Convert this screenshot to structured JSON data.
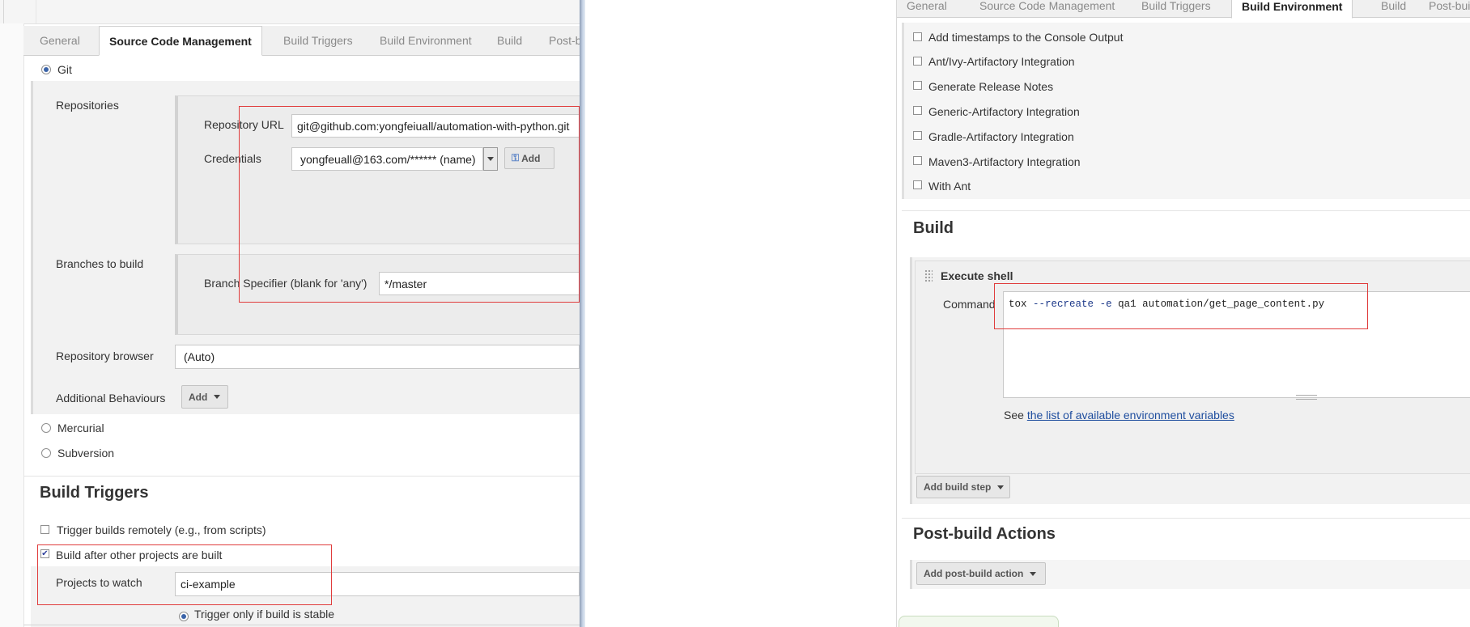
{
  "left_panel": {
    "tabs": [
      "General",
      "Source Code Management",
      "Build Triggers",
      "Build Environment",
      "Build",
      "Post-b"
    ],
    "active_tab": "Source Code Management",
    "scm": {
      "git_label": "Git",
      "repositories_label": "Repositories",
      "repo_url_label": "Repository URL",
      "repo_url_value": "git@github.com:yongfeiuall/automation-with-python.git",
      "credentials_label": "Credentials",
      "credentials_value": "yongfeuall@163.com/****** (name)",
      "add_cred_label": "Add",
      "branches_label": "Branches to build",
      "branch_specifier_label": "Branch Specifier (blank for 'any')",
      "branch_specifier_value": "*/master",
      "repo_browser_label": "Repository browser",
      "repo_browser_value": "(Auto)",
      "additional_behaviours_label": "Additional Behaviours",
      "add_behaviour_label": "Add",
      "mercurial_label": "Mercurial",
      "subversion_label": "Subversion"
    },
    "build_triggers": {
      "title": "Build Triggers",
      "trigger_remotely": "Trigger builds remotely (e.g., from scripts)",
      "build_after": "Build after other projects are built",
      "projects_to_watch_label": "Projects to watch",
      "projects_to_watch_value": "ci-example",
      "trigger_stable": "Trigger only if build is stable"
    }
  },
  "right_panel": {
    "tabs": [
      "General",
      "Source Code Management",
      "Build Triggers",
      "Build Environment",
      "Build",
      "Post-build"
    ],
    "active_tab": "Build Environment",
    "env_options": [
      "Add timestamps to the Console Output",
      "Ant/Ivy-Artifactory Integration",
      "Generate Release Notes",
      "Generic-Artifactory Integration",
      "Gradle-Artifactory Integration",
      "Maven3-Artifactory Integration",
      "With Ant"
    ],
    "build": {
      "title": "Build",
      "step_title": "Execute shell",
      "command_label": "Command",
      "cmd_tox": "tox",
      "cmd_flag1": "--recreate",
      "cmd_flag2": "-e",
      "cmd_rest": "qa1 automation/get_page_content.py",
      "see_label": "See",
      "env_vars_link": "the list of available environment variables",
      "add_build_step": "Add build step"
    },
    "post_build": {
      "title": "Post-build Actions",
      "add_post_build": "Add post-build action"
    }
  },
  "colors": {
    "highlight_red": "#e03c3c",
    "link_blue": "#1e4d9e",
    "active_radio": "#3a63a8"
  }
}
